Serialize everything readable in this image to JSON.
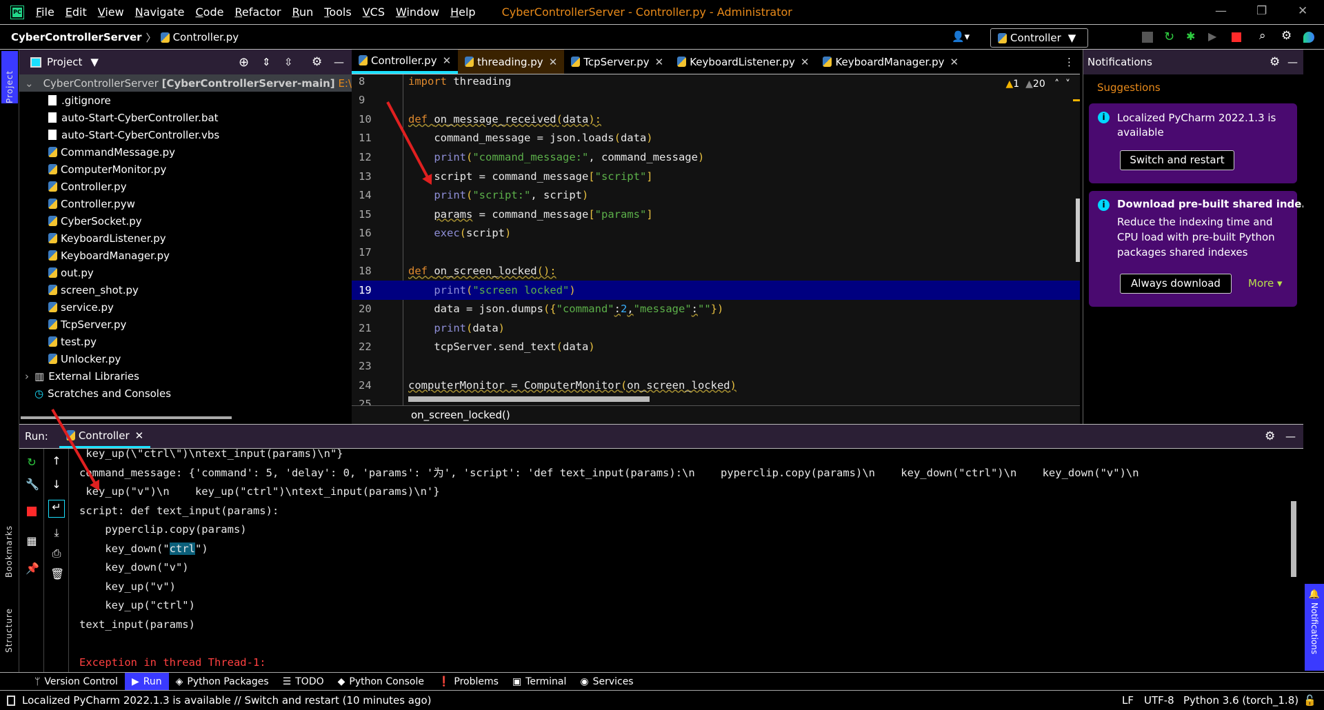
{
  "window": {
    "title": "CyberControllerServer - Controller.py - Administrator",
    "menu": [
      "File",
      "Edit",
      "View",
      "Navigate",
      "Code",
      "Refactor",
      "Run",
      "Tools",
      "VCS",
      "Window",
      "Help"
    ]
  },
  "navbar": {
    "project": "CyberControllerServer",
    "file": "Controller.py",
    "run_config": "Controller"
  },
  "left_stripe": {
    "project": "Project",
    "bookmarks": "Bookmarks",
    "structure": "Structure"
  },
  "project": {
    "title": "Project",
    "root": "CyberControllerServer",
    "root_bold": "[CyberControllerServer-main]",
    "root_path": "E:\\C",
    "files": [
      ".gitignore",
      "auto-Start-CyberController.bat",
      "auto-Start-CyberController.vbs",
      "CommandMessage.py",
      "ComputerMonitor.py",
      "Controller.py",
      "Controller.pyw",
      "CyberSocket.py",
      "KeyboardListener.py",
      "KeyboardManager.py",
      "out.py",
      "screen_shot.py",
      "service.py",
      "TcpServer.py",
      "test.py",
      "Unlocker.py"
    ],
    "external": "External Libraries",
    "scratches": "Scratches and Consoles"
  },
  "editor": {
    "tabs": [
      {
        "label": "Controller.py",
        "active": true
      },
      {
        "label": "threading.py"
      },
      {
        "label": "TcpServer.py"
      },
      {
        "label": "KeyboardListener.py"
      },
      {
        "label": "KeyboardManager.py"
      }
    ],
    "warnings": "1",
    "weak_warnings": "20",
    "current_line": 19,
    "lines": [
      {
        "n": "8",
        "t": [
          [
            "kw",
            "import "
          ],
          [
            "fn",
            "threading"
          ]
        ]
      },
      {
        "n": "9",
        "t": []
      },
      {
        "n": "10",
        "t": [
          [
            "kw wavy",
            "def "
          ],
          [
            "fn wavy",
            "on_message_received"
          ],
          [
            "br wavy",
            "("
          ],
          [
            "fn wavy",
            "data"
          ],
          [
            "br wavy",
            "):"
          ]
        ]
      },
      {
        "n": "11",
        "t": [
          [
            "fn",
            "    command_message = json.loads"
          ],
          [
            "br",
            "("
          ],
          [
            "fn",
            "data"
          ],
          [
            "br",
            ")"
          ]
        ]
      },
      {
        "n": "12",
        "t": [
          [
            "bi",
            "    print"
          ],
          [
            "br",
            "("
          ],
          [
            "st",
            "\"command_message:\""
          ],
          [
            "fn",
            ", command_message"
          ],
          [
            "br",
            ")"
          ]
        ]
      },
      {
        "n": "13",
        "t": [
          [
            "fn",
            "    script = command_message"
          ],
          [
            "br",
            "["
          ],
          [
            "st",
            "\"script\""
          ],
          [
            "br",
            "]"
          ]
        ]
      },
      {
        "n": "14",
        "t": [
          [
            "bi",
            "    print"
          ],
          [
            "br",
            "("
          ],
          [
            "st",
            "\"script:\""
          ],
          [
            "fn",
            ", script"
          ],
          [
            "br",
            ")"
          ]
        ]
      },
      {
        "n": "15",
        "t": [
          [
            "fn",
            "    "
          ],
          [
            "fn wavy",
            "params"
          ],
          [
            "fn",
            " = command_message"
          ],
          [
            "br",
            "["
          ],
          [
            "st",
            "\"params\""
          ],
          [
            "br",
            "]"
          ]
        ]
      },
      {
        "n": "16",
        "t": [
          [
            "bi",
            "    exec"
          ],
          [
            "br",
            "("
          ],
          [
            "fn",
            "script"
          ],
          [
            "br",
            ")"
          ]
        ]
      },
      {
        "n": "17",
        "t": []
      },
      {
        "n": "18",
        "t": [
          [
            "kw wavy",
            "def "
          ],
          [
            "fn wavy",
            "on_screen_locked"
          ],
          [
            "br wavy",
            "():"
          ]
        ]
      },
      {
        "n": "19",
        "t": [
          [
            "bi",
            "    print"
          ],
          [
            "br",
            "("
          ],
          [
            "st",
            "\"screen locked\""
          ],
          [
            "br",
            ")"
          ]
        ]
      },
      {
        "n": "20",
        "t": [
          [
            "fn",
            "    data = json.dumps"
          ],
          [
            "br",
            "({"
          ],
          [
            "st",
            "\"command\""
          ],
          [
            "fn wavy",
            ":"
          ],
          [
            "nm",
            "2"
          ],
          [
            "fn wavy",
            ","
          ],
          [
            "st",
            "\"message\""
          ],
          [
            "fn wavy",
            ":"
          ],
          [
            "st",
            "\"\""
          ],
          [
            "br",
            "})"
          ]
        ]
      },
      {
        "n": "21",
        "t": [
          [
            "bi",
            "    print"
          ],
          [
            "br",
            "("
          ],
          [
            "fn",
            "data"
          ],
          [
            "br",
            ")"
          ]
        ]
      },
      {
        "n": "22",
        "t": [
          [
            "fn",
            "    tcpServer.send_text"
          ],
          [
            "br",
            "("
          ],
          [
            "fn",
            "data"
          ],
          [
            "br",
            ")"
          ]
        ]
      },
      {
        "n": "23",
        "t": []
      },
      {
        "n": "24",
        "t": [
          [
            "fn wavy",
            "computerMonitor = ComputerMonitor"
          ],
          [
            "br wavy",
            "("
          ],
          [
            "fn wavy",
            "on_screen_locked"
          ],
          [
            "br wavy",
            ")"
          ]
        ]
      },
      {
        "n": "25",
        "t": []
      }
    ],
    "breadcrumb": "on_screen_locked()"
  },
  "notifications": {
    "title": "Notifications",
    "section": "Suggestions",
    "cards": [
      {
        "text": "Localized PyCharm 2022.1.3 is available",
        "button": "Switch and restart"
      },
      {
        "title": "Download pre-built shared inde...",
        "text": "Reduce the indexing time and CPU load with pre-built Python packages shared indexes",
        "button": "Always download",
        "more": "More"
      }
    ],
    "stripe_label": "Notifications"
  },
  "run": {
    "label": "Run:",
    "tab": "Controller",
    "output": [
      " key_up(\\\"ctrl\\\")\\ntext_input(params)\\n\"}",
      "command_message: {'command': 5, 'delay': 0, 'params': '为', 'script': 'def text_input(params):\\n    pyperclip.copy(params)\\n    key_down(\"ctrl\")\\n    key_down(\"v\")\\n",
      " key_up(\"v\")\\n    key_up(\"ctrl\")\\ntext_input(params)\\n'}",
      "script: def text_input(params):",
      "    pyperclip.copy(params)",
      "    key_down(\"ctrl\")",
      "    key_down(\"v\")",
      "    key_up(\"v\")",
      "    key_up(\"ctrl\")",
      "text_input(params)",
      "",
      "Exception in thread Thread-1:"
    ]
  },
  "bottom_tabs": [
    {
      "label": "Version Control",
      "icon": "vcs-icon"
    },
    {
      "label": "Run",
      "icon": "run-icon",
      "active": true
    },
    {
      "label": "Python Packages",
      "icon": "packages-icon"
    },
    {
      "label": "TODO",
      "icon": "todo-icon"
    },
    {
      "label": "Python Console",
      "icon": "python-console-icon"
    },
    {
      "label": "Problems",
      "icon": "problems-icon"
    },
    {
      "label": "Terminal",
      "icon": "terminal-icon"
    },
    {
      "label": "Services",
      "icon": "services-icon"
    }
  ],
  "status": {
    "message": "Localized PyCharm 2022.1.3 is available // Switch and restart (10 minutes ago)",
    "line_sep": "LF",
    "encoding": "UTF-8",
    "interpreter": "Python 3.6 (torch_1.8)"
  },
  "colors": {
    "accent": "#00d8ff",
    "header": "#2b1f35",
    "card": "#4a0a70",
    "current_line": "#000080",
    "keyword": "#e08a2e",
    "string": "#5cb04a",
    "error": "#ff4040"
  }
}
